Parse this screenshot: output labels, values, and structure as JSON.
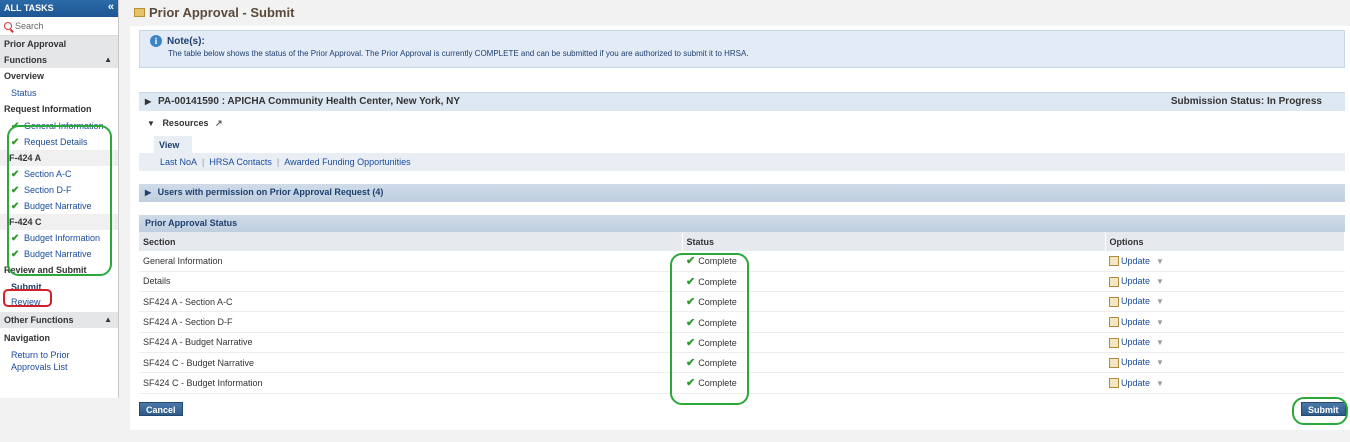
{
  "sidebar": {
    "header": "ALL TASKS",
    "collapse_icon": "double-chevron-left",
    "search_placeholder": "Search",
    "module": "Prior Approval",
    "functions_label": "Functions",
    "overview_label": "Overview",
    "status_link": "Status",
    "request_info_label": "Request Information",
    "request_items": [
      "General Information",
      "Request Details"
    ],
    "f424a_label": "F-424 A",
    "f424a_items": [
      "Section A-C",
      "Section D-F",
      "Budget Narrative"
    ],
    "f424c_label": "F-424 C",
    "f424c_items": [
      "Budget Information",
      "Budget Narrative"
    ],
    "review_submit_label": "Review and Submit",
    "submit_link": "Submit",
    "review_link": "Review",
    "other_functions_label": "Other Functions",
    "navigation_label": "Navigation",
    "return_link": "Return to Prior Approvals List"
  },
  "page": {
    "title": "Prior Approval - Submit"
  },
  "note": {
    "title": "Note(s):",
    "text": "The table below shows the status of the Prior Approval. The Prior Approval is currently COMPLETE and can be submitted if you are authorized to submit it to HRSA."
  },
  "pa_header": {
    "title": "PA-00141590 : APICHA Community Health Center, New York, NY",
    "submission_status": "Submission Status: In Progress"
  },
  "resources": {
    "title": "Resources",
    "tab": "View",
    "links": [
      "Last NoA",
      "HRSA Contacts",
      "Awarded Funding Opportunities"
    ]
  },
  "users_bar": {
    "title": "Users with permission on Prior Approval Request (4)"
  },
  "status_table": {
    "title": "Prior Approval Status",
    "columns": [
      "Section",
      "Status",
      "Options"
    ],
    "rows": [
      {
        "section": "General Information",
        "status": "Complete",
        "option": "Update"
      },
      {
        "section": "Details",
        "status": "Complete",
        "option": "Update"
      },
      {
        "section": "SF424 A - Section A-C",
        "status": "Complete",
        "option": "Update"
      },
      {
        "section": "SF424 A - Section D-F",
        "status": "Complete",
        "option": "Update"
      },
      {
        "section": "SF424 A - Budget Narrative",
        "status": "Complete",
        "option": "Update"
      },
      {
        "section": "SF424 C - Budget Narrative",
        "status": "Complete",
        "option": "Update"
      },
      {
        "section": "SF424 C - Budget Information",
        "status": "Complete",
        "option": "Update"
      }
    ]
  },
  "buttons": {
    "cancel": "Cancel",
    "submit": "Submit"
  },
  "colors": {
    "accent": "#2e5b8a",
    "check": "#2e9a2e",
    "highlight_green": "#2aa83a",
    "highlight_red": "#d0202a"
  }
}
